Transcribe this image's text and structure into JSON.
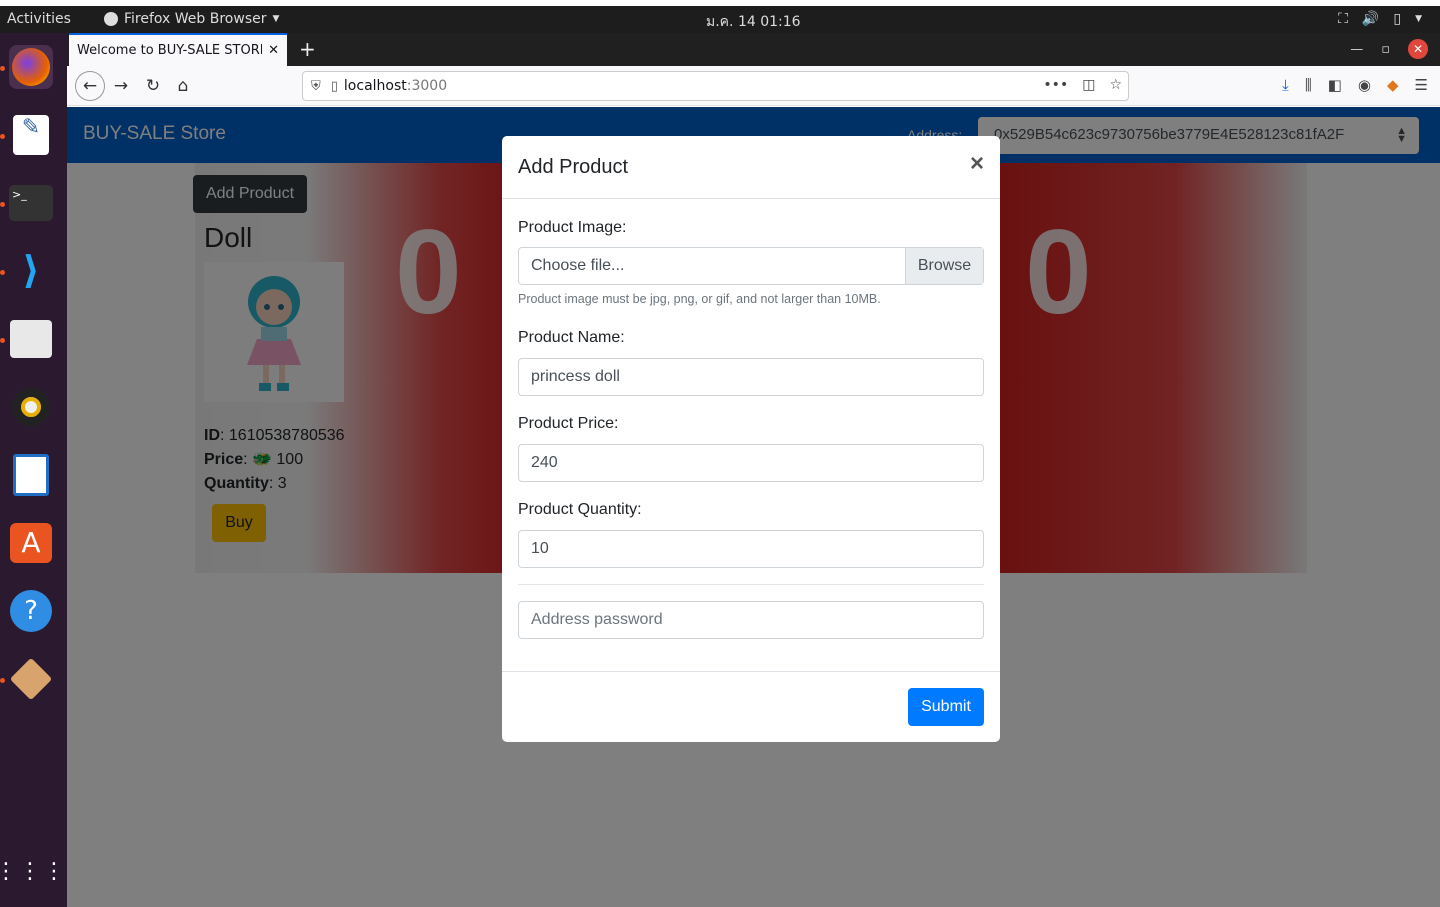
{
  "system": {
    "activities": "Activities",
    "app_name": "Firefox Web Browser",
    "clock": "ม.ค. 14  01:16"
  },
  "browser": {
    "tab_title": "Welcome to BUY-SALE STORE",
    "url_host": "localhost",
    "url_port": ":3000"
  },
  "site": {
    "brand": "BUY-SALE Store",
    "address_label": "Address:",
    "address_value": "0x529B54c623c9730756be3779E4E528123c81fA2F",
    "add_product_button": "Add Product"
  },
  "product": {
    "name": "Doll",
    "id_label": "ID",
    "id_value": ": 1610538780536",
    "price_label": "Price",
    "price_value": ": 🐲 100",
    "qty_label": "Quantity",
    "qty_value": ": 3",
    "buy_label": "Buy"
  },
  "modal": {
    "title": "Add Product",
    "close": "×",
    "image_label": "Product Image:",
    "file_placeholder": "Choose file...",
    "browse_label": "Browse",
    "image_hint": "Product image must be jpg, png, or gif, and not larger than 10MB.",
    "name_label": "Product Name:",
    "name_value": "princess doll",
    "price_label": "Product Price:",
    "price_value": "240",
    "qty_label": "Product Quantity:",
    "qty_value": "10",
    "password_placeholder": "Address password",
    "submit_label": "Submit"
  },
  "colors": {
    "brand_blue": "#0063cc",
    "primary": "#007bff",
    "warning": "#ffc107",
    "dark": "#343a40"
  }
}
